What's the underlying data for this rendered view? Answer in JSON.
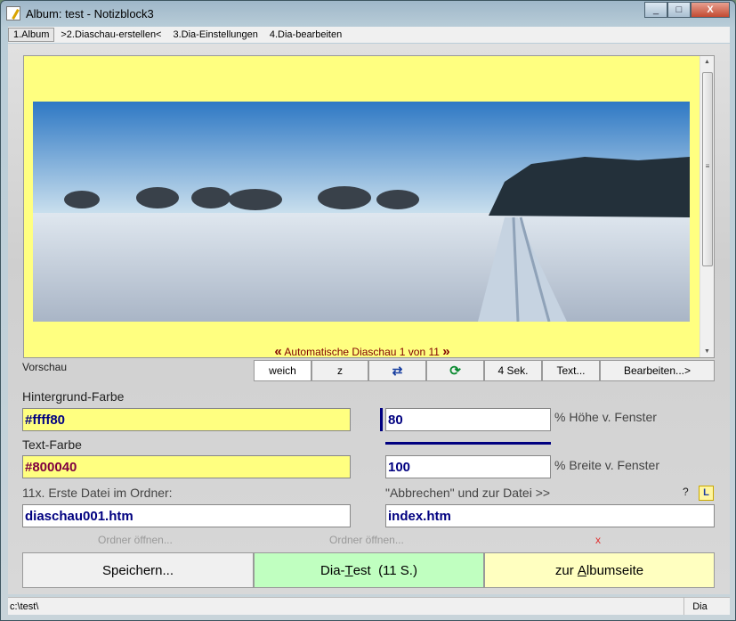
{
  "window": {
    "title": "Album: test  - Notizblock3",
    "min": "_",
    "max": "□",
    "close": "X"
  },
  "menu": [
    "1.Album",
    ">2.Diaschau-erstellen<",
    "3.Dia-Einstellungen",
    "4.Dia-bearbeiten"
  ],
  "preview": {
    "background_color": "#ffff80",
    "caption_prev": "«",
    "caption": "Automatische Diaschau 1 von 11",
    "caption_next": "»",
    "label": "Vorschau"
  },
  "toolbar": {
    "weich": "weich",
    "z": "z",
    "transition_icon": "swap-arrows-icon",
    "refresh_icon": "refresh-icon",
    "interval": "4 Sek.",
    "text": "Text...",
    "edit": "Bearbeiten...>"
  },
  "form": {
    "bg_label": "Hintergrund-Farbe",
    "bg_value": "#ffff80",
    "text_label": "Text-Farbe",
    "text_value": "#800040",
    "first_file_label": "11x. Erste Datei im Ordner:",
    "first_file_value": "diaschau001.htm",
    "height_value": "80",
    "height_label": "% Höhe v. Fenster",
    "width_value": "100",
    "width_label": "% Breite v. Fenster",
    "cancel_label": "\"Abbrechen\" und zur Datei  >>",
    "help": "?",
    "l_icon": "L",
    "cancel_file_value": "index.htm",
    "open_folder_1": "Ordner öffnen...",
    "open_folder_2": "Ordner öffnen...",
    "clear": "x"
  },
  "buttons": {
    "save": "Speichern...",
    "test_pre": "Dia-",
    "test_key": "T",
    "test_post": "est  (11 S.)",
    "album_pre": "zur ",
    "album_key": "A",
    "album_post": "lbumseite"
  },
  "status": {
    "path": "c:\\test\\",
    "mode": "Dia"
  }
}
